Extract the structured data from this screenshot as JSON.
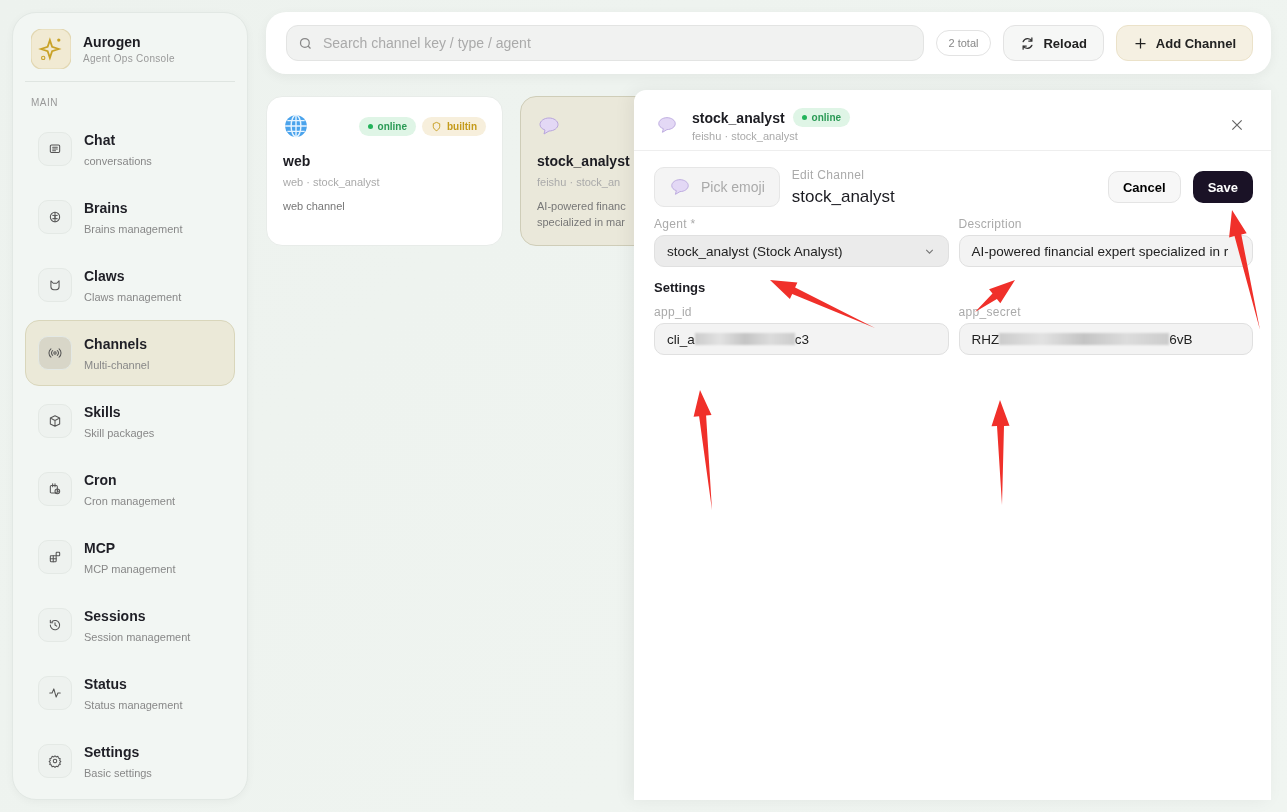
{
  "brand": {
    "name": "Aurogen",
    "subtitle": "Agent Ops Console"
  },
  "sidebar": {
    "section": "MAIN",
    "items": [
      {
        "title": "Chat",
        "subtitle": "conversations",
        "selected": false
      },
      {
        "title": "Brains",
        "subtitle": "Brains management",
        "selected": false
      },
      {
        "title": "Claws",
        "subtitle": "Claws management",
        "selected": false
      },
      {
        "title": "Channels",
        "subtitle": "Multi-channel",
        "selected": true
      },
      {
        "title": "Skills",
        "subtitle": "Skill packages",
        "selected": false
      },
      {
        "title": "Cron",
        "subtitle": "Cron management",
        "selected": false
      },
      {
        "title": "MCP",
        "subtitle": "MCP management",
        "selected": false
      },
      {
        "title": "Sessions",
        "subtitle": "Session management",
        "selected": false
      },
      {
        "title": "Status",
        "subtitle": "Status management",
        "selected": false
      },
      {
        "title": "Settings",
        "subtitle": "Basic settings",
        "selected": false
      }
    ]
  },
  "toolbar": {
    "search": {
      "placeholder": "Search channel key / type / agent"
    },
    "count": "2 total",
    "reload": "Reload",
    "add": "Add Channel"
  },
  "channels": [
    {
      "kind": "web",
      "name": "web",
      "meta": "web · stock_analyst",
      "description": "web channel",
      "status": "online",
      "builtin": "builtin",
      "selected": false
    },
    {
      "kind": "chat",
      "name": "stock_analyst",
      "meta": "feishu · stock_an",
      "description_lines": [
        "AI-powered financ",
        "specialized in mar"
      ],
      "selected": true
    }
  ],
  "drawer": {
    "title": "stock_analyst",
    "status": "online",
    "meta": "feishu · stock_analyst",
    "pick_emoji": "Pick emoji",
    "mode": "Edit Channel",
    "name": "stock_analyst",
    "cancel": "Cancel",
    "save": "Save",
    "agent": {
      "label": "Agent *",
      "value": "stock_analyst (Stock Analyst)"
    },
    "description": {
      "label": "Description",
      "value": "AI-powered financial expert specialized in r"
    },
    "settings": "Settings",
    "fields": [
      {
        "label": "app_id",
        "value_start": "cli_a",
        "value_end": "c3",
        "redacted": true
      },
      {
        "label": "app_secret",
        "value_start": "RHZ",
        "value_end": "6vB",
        "redacted": true
      }
    ]
  }
}
